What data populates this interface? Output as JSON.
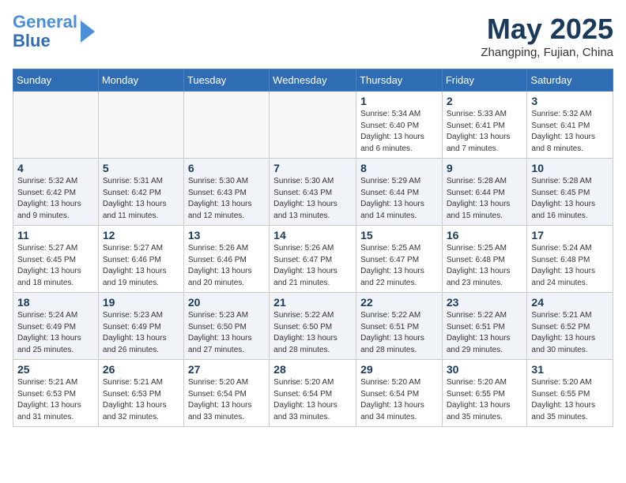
{
  "logo": {
    "line1": "General",
    "line2": "Blue"
  },
  "title": "May 2025",
  "subtitle": "Zhangping, Fujian, China",
  "days_of_week": [
    "Sunday",
    "Monday",
    "Tuesday",
    "Wednesday",
    "Thursday",
    "Friday",
    "Saturday"
  ],
  "weeks": [
    [
      {
        "num": "",
        "info": ""
      },
      {
        "num": "",
        "info": ""
      },
      {
        "num": "",
        "info": ""
      },
      {
        "num": "",
        "info": ""
      },
      {
        "num": "1",
        "info": "Sunrise: 5:34 AM\nSunset: 6:40 PM\nDaylight: 13 hours\nand 6 minutes."
      },
      {
        "num": "2",
        "info": "Sunrise: 5:33 AM\nSunset: 6:41 PM\nDaylight: 13 hours\nand 7 minutes."
      },
      {
        "num": "3",
        "info": "Sunrise: 5:32 AM\nSunset: 6:41 PM\nDaylight: 13 hours\nand 8 minutes."
      }
    ],
    [
      {
        "num": "4",
        "info": "Sunrise: 5:32 AM\nSunset: 6:42 PM\nDaylight: 13 hours\nand 9 minutes."
      },
      {
        "num": "5",
        "info": "Sunrise: 5:31 AM\nSunset: 6:42 PM\nDaylight: 13 hours\nand 11 minutes."
      },
      {
        "num": "6",
        "info": "Sunrise: 5:30 AM\nSunset: 6:43 PM\nDaylight: 13 hours\nand 12 minutes."
      },
      {
        "num": "7",
        "info": "Sunrise: 5:30 AM\nSunset: 6:43 PM\nDaylight: 13 hours\nand 13 minutes."
      },
      {
        "num": "8",
        "info": "Sunrise: 5:29 AM\nSunset: 6:44 PM\nDaylight: 13 hours\nand 14 minutes."
      },
      {
        "num": "9",
        "info": "Sunrise: 5:28 AM\nSunset: 6:44 PM\nDaylight: 13 hours\nand 15 minutes."
      },
      {
        "num": "10",
        "info": "Sunrise: 5:28 AM\nSunset: 6:45 PM\nDaylight: 13 hours\nand 16 minutes."
      }
    ],
    [
      {
        "num": "11",
        "info": "Sunrise: 5:27 AM\nSunset: 6:45 PM\nDaylight: 13 hours\nand 18 minutes."
      },
      {
        "num": "12",
        "info": "Sunrise: 5:27 AM\nSunset: 6:46 PM\nDaylight: 13 hours\nand 19 minutes."
      },
      {
        "num": "13",
        "info": "Sunrise: 5:26 AM\nSunset: 6:46 PM\nDaylight: 13 hours\nand 20 minutes."
      },
      {
        "num": "14",
        "info": "Sunrise: 5:26 AM\nSunset: 6:47 PM\nDaylight: 13 hours\nand 21 minutes."
      },
      {
        "num": "15",
        "info": "Sunrise: 5:25 AM\nSunset: 6:47 PM\nDaylight: 13 hours\nand 22 minutes."
      },
      {
        "num": "16",
        "info": "Sunrise: 5:25 AM\nSunset: 6:48 PM\nDaylight: 13 hours\nand 23 minutes."
      },
      {
        "num": "17",
        "info": "Sunrise: 5:24 AM\nSunset: 6:48 PM\nDaylight: 13 hours\nand 24 minutes."
      }
    ],
    [
      {
        "num": "18",
        "info": "Sunrise: 5:24 AM\nSunset: 6:49 PM\nDaylight: 13 hours\nand 25 minutes."
      },
      {
        "num": "19",
        "info": "Sunrise: 5:23 AM\nSunset: 6:49 PM\nDaylight: 13 hours\nand 26 minutes."
      },
      {
        "num": "20",
        "info": "Sunrise: 5:23 AM\nSunset: 6:50 PM\nDaylight: 13 hours\nand 27 minutes."
      },
      {
        "num": "21",
        "info": "Sunrise: 5:22 AM\nSunset: 6:50 PM\nDaylight: 13 hours\nand 28 minutes."
      },
      {
        "num": "22",
        "info": "Sunrise: 5:22 AM\nSunset: 6:51 PM\nDaylight: 13 hours\nand 28 minutes."
      },
      {
        "num": "23",
        "info": "Sunrise: 5:22 AM\nSunset: 6:51 PM\nDaylight: 13 hours\nand 29 minutes."
      },
      {
        "num": "24",
        "info": "Sunrise: 5:21 AM\nSunset: 6:52 PM\nDaylight: 13 hours\nand 30 minutes."
      }
    ],
    [
      {
        "num": "25",
        "info": "Sunrise: 5:21 AM\nSunset: 6:53 PM\nDaylight: 13 hours\nand 31 minutes."
      },
      {
        "num": "26",
        "info": "Sunrise: 5:21 AM\nSunset: 6:53 PM\nDaylight: 13 hours\nand 32 minutes."
      },
      {
        "num": "27",
        "info": "Sunrise: 5:20 AM\nSunset: 6:54 PM\nDaylight: 13 hours\nand 33 minutes."
      },
      {
        "num": "28",
        "info": "Sunrise: 5:20 AM\nSunset: 6:54 PM\nDaylight: 13 hours\nand 33 minutes."
      },
      {
        "num": "29",
        "info": "Sunrise: 5:20 AM\nSunset: 6:54 PM\nDaylight: 13 hours\nand 34 minutes."
      },
      {
        "num": "30",
        "info": "Sunrise: 5:20 AM\nSunset: 6:55 PM\nDaylight: 13 hours\nand 35 minutes."
      },
      {
        "num": "31",
        "info": "Sunrise: 5:20 AM\nSunset: 6:55 PM\nDaylight: 13 hours\nand 35 minutes."
      }
    ]
  ]
}
